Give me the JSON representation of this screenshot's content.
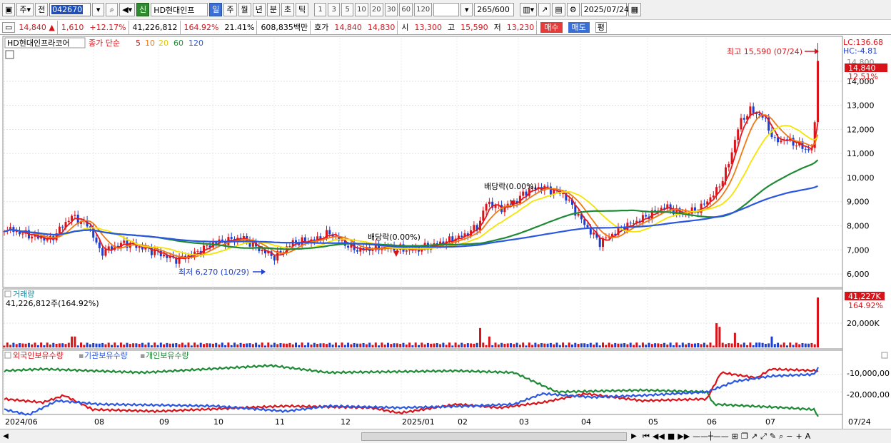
{
  "toolbar": {
    "market_label": "주",
    "prev_label": "전",
    "stock_code": "042670",
    "new_badge": "신",
    "stock_name": "HD현대인프",
    "periods": [
      "일",
      "주",
      "월",
      "년",
      "분",
      "초",
      "틱"
    ],
    "selected_period": "일",
    "multipliers": [
      "1",
      "3",
      "5",
      "10",
      "20",
      "30",
      "60",
      "120"
    ],
    "count_value": "265",
    "count_max": "/600",
    "date_value": "2025/07/24"
  },
  "quote": {
    "price": "14,840",
    "change_symbol": "▲",
    "change": "1,610",
    "change_pct": "+12.17%",
    "volume": "41,226,812",
    "volume_ratio": "164.92%",
    "turnover": "21.41%",
    "amount": "608,835백만",
    "bid_label": "호가",
    "ask": "14,840",
    "bid": "14,830",
    "open_label": "시",
    "open": "13,300",
    "high_label": "고",
    "high": "15,590",
    "low_label": "저",
    "low": "13,230",
    "buy_button": "매수",
    "sell_button": "매도",
    "eval_button": "평"
  },
  "price_panel": {
    "legend_name": "HD현대인프라코어",
    "legend_type": "종가 단순",
    "ma_periods": [
      "5",
      "10",
      "20",
      "60",
      "120"
    ],
    "ma_colors": [
      "#e8171f",
      "#f07a12",
      "#f5e400",
      "#1f8a35",
      "#2a57e0"
    ],
    "lc_label": "LC:136.68",
    "hc_label": "HC:-4.81",
    "high_note": "최고 15,590 (07/24)",
    "low_note": "최저 6,270 (10/29)",
    "dividend_notes": [
      "배당락(0.00%)",
      "배당락(0.00%)"
    ],
    "current_price_tag": "14,840",
    "current_pct_tag": "12.51%",
    "y_ticks": [
      "6,000",
      "7,000",
      "8,000",
      "9,000",
      "10,000",
      "11,000",
      "12,000",
      "13,000",
      "14,000",
      "14,800"
    ]
  },
  "volume_panel": {
    "title": "거래량",
    "subtitle": "41,226,812주(164.92%)",
    "tag_value": "41,227K",
    "tag_pct": "164.92%",
    "y_tick": "20,000K"
  },
  "holdings_panel": {
    "legends": [
      "외국인보유수량",
      "기관보유수량",
      "개인보유수량"
    ],
    "colors": [
      "#d8141b",
      "#2a57e0",
      "#1f8a35"
    ],
    "y_ticks": [
      "-10,000,00",
      "-20,000,00"
    ]
  },
  "x_labels": [
    "2024/06",
    "08",
    "09",
    "10",
    "11",
    "12",
    "2025/01",
    "02",
    "03",
    "04",
    "05",
    "06",
    "07"
  ],
  "x_end_label": "07/24",
  "chart_data": {
    "type": "line",
    "title": "HD현대인프라코어",
    "x": [
      "2024-06",
      "2024-07",
      "2024-08",
      "2024-09",
      "2024-10",
      "2024-11",
      "2024-12",
      "2025-01",
      "2025-02",
      "2025-03",
      "2025-04",
      "2025-05",
      "2025-06",
      "2025-07",
      "2025-07-24"
    ],
    "series": [
      {
        "name": "종가",
        "values": [
          7900,
          8200,
          7200,
          6800,
          7000,
          7300,
          7100,
          7000,
          8500,
          9500,
          7600,
          8500,
          11500,
          11200,
          14840
        ]
      },
      {
        "name": "120",
        "values": [
          8000,
          8000,
          7900,
          7700,
          7600,
          7500,
          7400,
          7300,
          7300,
          7500,
          7800,
          8000,
          8300,
          9200,
          9500
        ]
      }
    ],
    "ylim": [
      5500,
      15800
    ],
    "volume_values_k": [
      5000,
      8000,
      3000,
      2000,
      3500,
      3000,
      2000,
      2500,
      14000,
      6000,
      3000,
      3000,
      15000,
      9000,
      41227
    ]
  }
}
